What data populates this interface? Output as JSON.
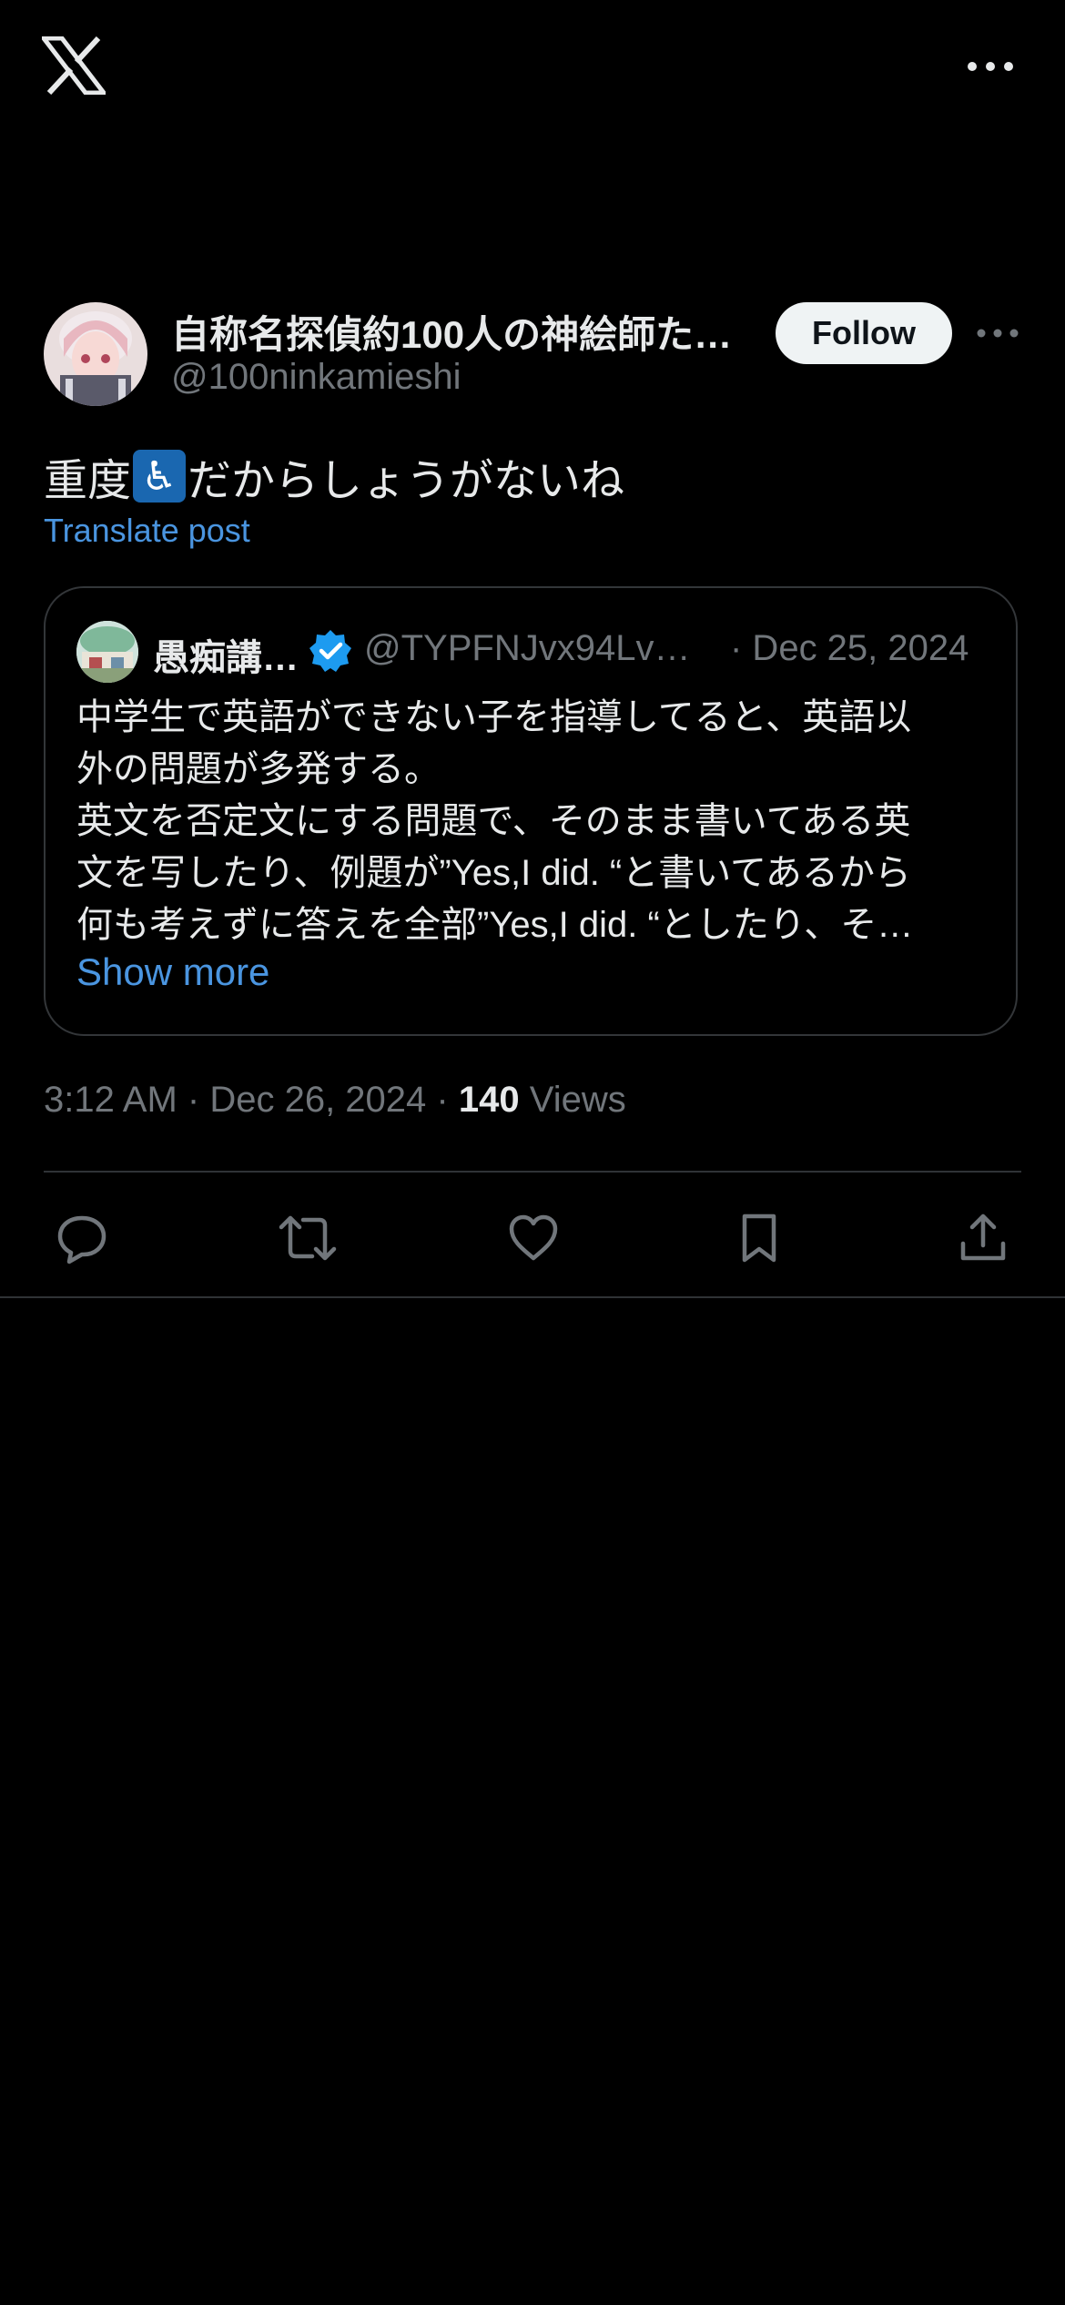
{
  "topbar": {
    "logo_icon": "x-logo-icon",
    "more_icon": "more-horizontal-icon"
  },
  "post": {
    "author_name": "自称名探偵約100人の神絵師た…",
    "author_handle": "@100ninkamieshi",
    "follow_label": "Follow",
    "text_before": "重度",
    "emoji": "♿",
    "text_after": "だからしょうがないね",
    "translate_label": "Translate post",
    "time": "3:12 AM",
    "date": "Dec 26, 2024",
    "sep": "·",
    "views_count": "140",
    "views_label": "Views"
  },
  "quote": {
    "name": "愚痴講…",
    "handle": "@TYPFNJvx94LvM…",
    "date": "· Dec 25, 2024",
    "lines": [
      "中学生で英語ができない子を指導してると、英語以",
      "外の問題が多発する。",
      "英文を否定文にする問題で、そのまま書いてある英",
      "文を写したり、例題が”Yes,I did. “と書いてあるから",
      "何も考えずに答えを全部”Yes,I did. “としたり、そ…"
    ],
    "show_more": "Show more"
  },
  "actions": [
    "reply-icon",
    "repost-icon",
    "like-icon",
    "bookmark-icon",
    "share-icon"
  ],
  "colors": {
    "background": "#000000",
    "text": "#e7e9ea",
    "secondary": "#71767b",
    "link": "#4a95e0",
    "verified": "#1d9bf0",
    "border": "#2f3336"
  }
}
